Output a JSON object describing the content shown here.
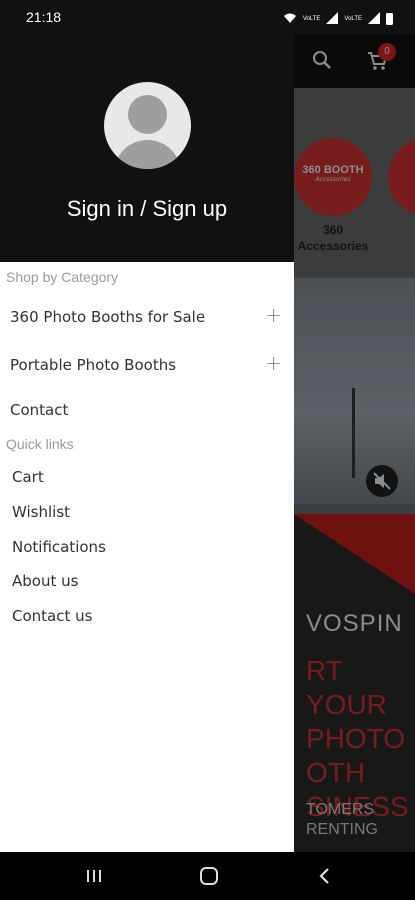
{
  "status_bar": {
    "time": "21:18",
    "signal_label_1": "VoLTE",
    "signal_label_2": "VoLTE"
  },
  "drawer": {
    "sign_in_label": "Sign in / Sign up",
    "shop_by_category_label": "Shop by Category",
    "categories": [
      {
        "label": "360 Photo Booths for Sale",
        "expandable": true
      },
      {
        "label": "Portable Photo Booths",
        "expandable": true
      },
      {
        "label": "Contact",
        "expandable": false
      }
    ],
    "quick_links_label": "Quick links",
    "quick_links": [
      {
        "label": "Cart"
      },
      {
        "label": "Wishlist"
      },
      {
        "label": "Notifications"
      },
      {
        "label": "About us"
      },
      {
        "label": "Contact us"
      }
    ]
  },
  "background_app": {
    "cart_count": "0",
    "category_logo_text": "360 BOOTH",
    "category_logo_sub": "Accessories",
    "category_label_line1": "360",
    "category_label_line2": "Accessories",
    "banner_brand": "VOSPIN",
    "banner_headline_1": "RT YOUR",
    "banner_headline_2": "PHOTO",
    "banner_headline_3": "OTH",
    "banner_headline_4": "SINESS",
    "banner_sub_1": "TOMERS",
    "banner_sub_2": "RENTING"
  },
  "colors": {
    "accent_red": "#d83333",
    "header_dark": "#111111",
    "drawer_bg": "#ffffff"
  },
  "icons": {
    "search": "search-icon",
    "cart": "cart-icon",
    "mute": "mute-icon",
    "plus": "plus-icon",
    "nav_recents": "recents-icon",
    "nav_home": "home-icon",
    "nav_back": "back-icon"
  }
}
